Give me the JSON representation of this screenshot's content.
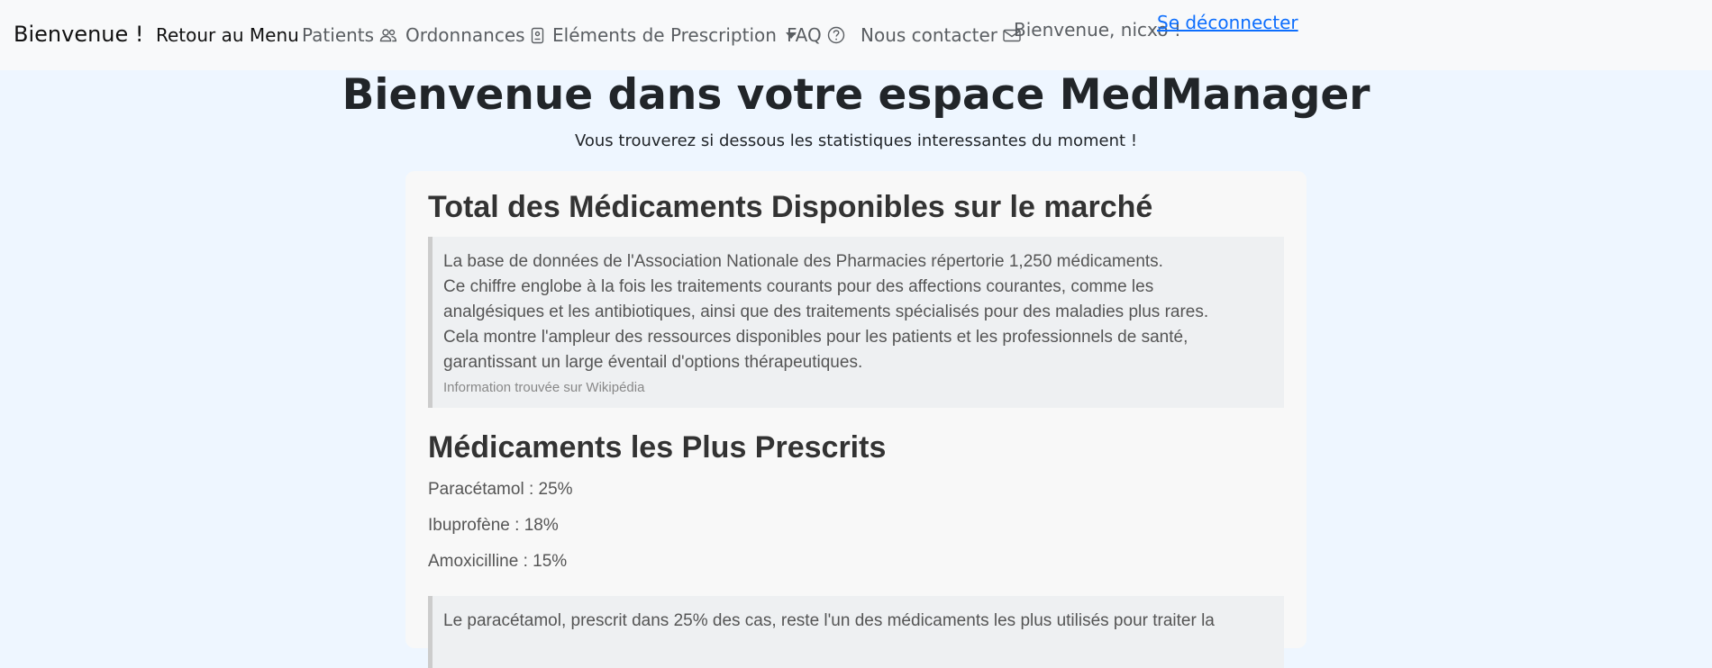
{
  "navbar": {
    "brand": "Bienvenue !",
    "items": [
      {
        "label": "Retour au Menu",
        "icon": ""
      },
      {
        "label": "Patients",
        "icon": "people-icon"
      },
      {
        "label": "Ordonnances",
        "icon": "document-icon"
      },
      {
        "label": "Eléments de Prescription",
        "icon": "caret-down-icon"
      },
      {
        "label": "FAQ",
        "icon": "question-circle-icon"
      },
      {
        "label": "Nous contacter",
        "icon": "envelope-icon"
      }
    ],
    "welcome_user": "Bienvenue, nicxo !",
    "logout": "Se déconnecter"
  },
  "hero": {
    "title": "Bienvenue dans votre espace MedManager",
    "subtitle": "Vous trouverez si dessous les statistiques interessantes du moment !"
  },
  "card": {
    "section1": {
      "title": "Total des Médicaments Disponibles sur le marché",
      "paragraph": "La base de données de l'Association Nationale des Pharmacies répertorie 1,250 médicaments.\nCe chiffre englobe à la fois les traitements courants pour des affections courantes, comme les analgésiques et les antibiotiques, ainsi que des traitements spécialisés pour des maladies plus rares.\nCela montre l'ampleur des ressources disponibles pour les patients et les professionnels de santé, garantissant un large éventail d'options thérapeutiques.",
      "lines": [
        "La base de données de l'Association Nationale des Pharmacies répertorie 1,250 médicaments.",
        "Ce chiffre englobe à la fois les traitements courants pour des affections courantes, comme les",
        "analgésiques et les antibiotiques, ainsi que des traitements spécialisés pour des maladies plus rares.",
        "Cela montre l'ampleur des ressources disponibles pour les patients et les professionnels de santé,",
        "garantissant un large éventail d'options thérapeutiques."
      ],
      "source": "Information trouvée sur Wikipédia"
    },
    "section2": {
      "title": "Médicaments les Plus Prescrits",
      "stats": [
        "Paracétamol : 25%",
        "Ibuprofène : 18%",
        "Amoxicilline : 15%"
      ],
      "quote_line": "Le paracétamol, prescrit dans 25% des cas, reste l'un des médicaments les plus utilisés pour traiter la"
    }
  },
  "colors": {
    "page_bg": "#eef6ff",
    "navbar_bg": "#f8f9fa",
    "link": "#0d6efd",
    "card_bg": "#f8f8f8",
    "quote_bg": "#eef0f2"
  }
}
